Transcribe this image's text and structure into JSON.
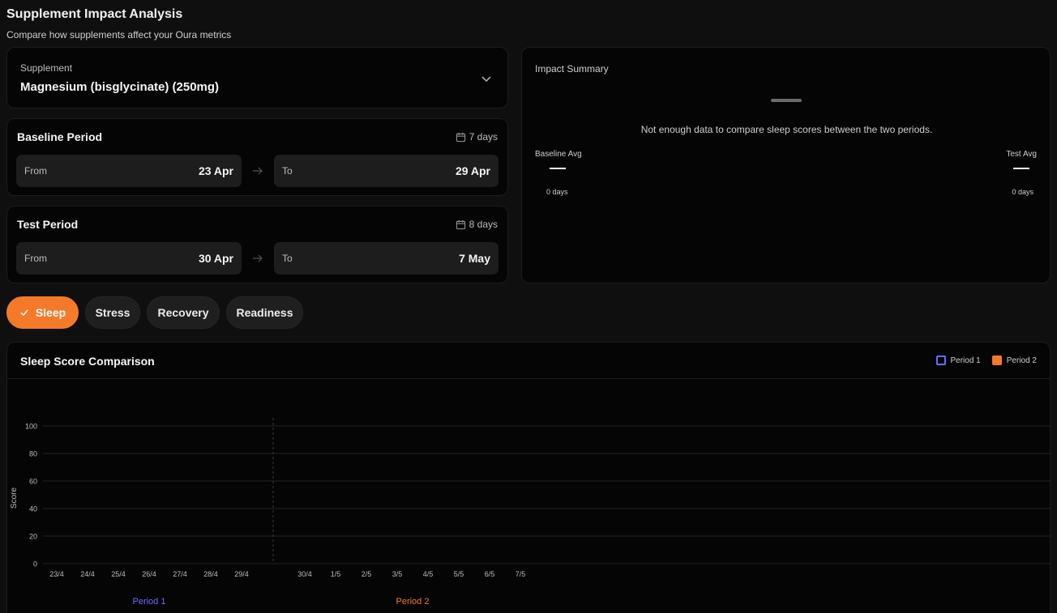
{
  "header": {
    "title": "Supplement Impact Analysis",
    "subtitle": "Compare how supplements affect your Oura metrics"
  },
  "supplement": {
    "label": "Supplement",
    "value": "Magnesium (bisglycinate) (250mg)"
  },
  "baseline": {
    "title": "Baseline Period",
    "days": "7 days",
    "from_label": "From",
    "from_value": "23 Apr",
    "to_label": "To",
    "to_value": "29 Apr"
  },
  "test": {
    "title": "Test Period",
    "days": "8 days",
    "from_label": "From",
    "from_value": "30 Apr",
    "to_label": "To",
    "to_value": "7 May"
  },
  "summary": {
    "title": "Impact Summary",
    "message": "Not enough data to compare sleep scores between the two periods.",
    "baseline_label": "Baseline Avg",
    "baseline_days": "0 days",
    "test_label": "Test Avg",
    "test_days": "0 days"
  },
  "tabs": [
    {
      "label": "Sleep",
      "active": true
    },
    {
      "label": "Stress",
      "active": false
    },
    {
      "label": "Recovery",
      "active": false
    },
    {
      "label": "Readiness",
      "active": false
    }
  ],
  "colors": {
    "accent": "#f47a2a",
    "period1": "#6b6bff",
    "period2": "#f47a2a"
  },
  "chart": {
    "title": "Sleep Score Comparison",
    "legend_period1": "Period 1",
    "legend_period2": "Period 2"
  },
  "chart_data": {
    "type": "line",
    "title": "Sleep Score Comparison",
    "ylabel": "Score",
    "ylim": [
      0,
      100
    ],
    "yticks": [
      0,
      20,
      40,
      60,
      80,
      100
    ],
    "grid": true,
    "legend": "top-right",
    "categories_period1": [
      "23/4",
      "24/4",
      "25/4",
      "26/4",
      "27/4",
      "28/4",
      "29/4"
    ],
    "categories_period2": [
      "30/4",
      "1/5",
      "2/5",
      "3/5",
      "4/5",
      "5/5",
      "6/5",
      "7/5"
    ],
    "group_labels": [
      "Period 1",
      "Period 2"
    ],
    "series": [
      {
        "name": "Period 1",
        "values": []
      },
      {
        "name": "Period 2",
        "values": []
      }
    ]
  }
}
